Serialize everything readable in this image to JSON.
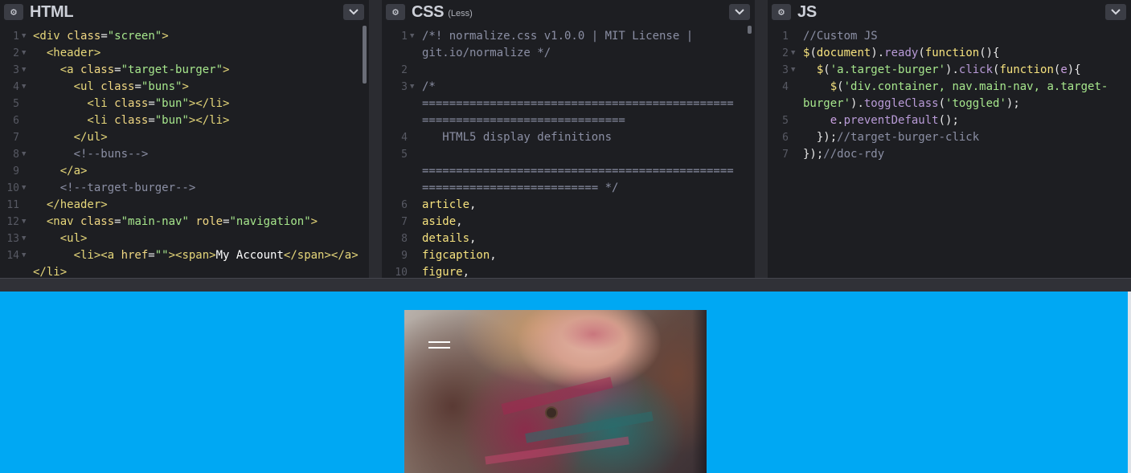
{
  "editors": {
    "html": {
      "title": "HTML",
      "lines": [
        {
          "n": "1",
          "fold": true,
          "segs": [
            [
              "c-tag",
              "<div "
            ],
            [
              "c-attr",
              "class"
            ],
            [
              "c-punc",
              "="
            ],
            [
              "c-str",
              "\"screen\""
            ],
            [
              "c-tag",
              ">"
            ]
          ]
        },
        {
          "n": "2",
          "fold": true,
          "segs": [
            [
              "c-tag",
              "  <header>"
            ]
          ]
        },
        {
          "n": "3",
          "fold": true,
          "segs": [
            [
              "c-tag",
              "    <a "
            ],
            [
              "c-attr",
              "class"
            ],
            [
              "c-punc",
              "="
            ],
            [
              "c-str",
              "\"target-burger\""
            ],
            [
              "c-tag",
              ">"
            ]
          ]
        },
        {
          "n": "4",
          "fold": true,
          "segs": [
            [
              "c-tag",
              "      <ul "
            ],
            [
              "c-attr",
              "class"
            ],
            [
              "c-punc",
              "="
            ],
            [
              "c-str",
              "\"buns\""
            ],
            [
              "c-tag",
              ">"
            ]
          ]
        },
        {
          "n": "5",
          "fold": false,
          "segs": [
            [
              "c-tag",
              "        <li "
            ],
            [
              "c-attr",
              "class"
            ],
            [
              "c-punc",
              "="
            ],
            [
              "c-str",
              "\"bun\""
            ],
            [
              "c-tag",
              "></li>"
            ]
          ]
        },
        {
          "n": "6",
          "fold": false,
          "segs": [
            [
              "c-tag",
              "        <li "
            ],
            [
              "c-attr",
              "class"
            ],
            [
              "c-punc",
              "="
            ],
            [
              "c-str",
              "\"bun\""
            ],
            [
              "c-tag",
              "></li>"
            ]
          ]
        },
        {
          "n": "7",
          "fold": false,
          "segs": [
            [
              "c-tag",
              "      </ul>"
            ]
          ]
        },
        {
          "n": "8",
          "fold": true,
          "segs": [
            [
              "c-comment",
              "      <!--buns-->"
            ]
          ]
        },
        {
          "n": "9",
          "fold": false,
          "segs": [
            [
              "c-tag",
              "    </a>"
            ]
          ]
        },
        {
          "n": "10",
          "fold": true,
          "segs": [
            [
              "c-comment",
              "    <!--target-burger-->"
            ]
          ]
        },
        {
          "n": "11",
          "fold": false,
          "segs": [
            [
              "c-tag",
              "  </header>"
            ]
          ]
        },
        {
          "n": "12",
          "fold": true,
          "segs": [
            [
              "c-tag",
              "  <nav "
            ],
            [
              "c-attr",
              "class"
            ],
            [
              "c-punc",
              "="
            ],
            [
              "c-str",
              "\"main-nav\""
            ],
            [
              "c-attr",
              " role"
            ],
            [
              "c-punc",
              "="
            ],
            [
              "c-str",
              "\"navigation\""
            ],
            [
              "c-tag",
              ">"
            ]
          ]
        },
        {
          "n": "13",
          "fold": true,
          "segs": [
            [
              "c-tag",
              "    <ul>"
            ]
          ]
        },
        {
          "n": "14",
          "fold": true,
          "segs": [
            [
              "c-tag",
              "      <li><a "
            ],
            [
              "c-attr",
              "href"
            ],
            [
              "c-punc",
              "="
            ],
            [
              "c-str",
              "\"\""
            ],
            [
              "c-tag",
              "><span>"
            ],
            [
              "c-text",
              "My Account"
            ],
            [
              "c-tag",
              "</span></a>"
            ]
          ]
        },
        {
          "n": "",
          "fold": false,
          "segs": [
            [
              "c-tag",
              "</li>"
            ]
          ]
        }
      ]
    },
    "css": {
      "title": "CSS",
      "subtitle": "(Less)",
      "lines": [
        {
          "n": "1",
          "fold": true,
          "segs": [
            [
              "c-comment",
              "/*! normalize.css v1.0.0 | MIT License |"
            ]
          ]
        },
        {
          "n": "",
          "fold": false,
          "segs": [
            [
              "c-comment",
              "git.io/normalize */"
            ]
          ]
        },
        {
          "n": "2",
          "fold": false,
          "segs": [
            [
              "c-comment",
              ""
            ]
          ]
        },
        {
          "n": "3",
          "fold": true,
          "segs": [
            [
              "c-comment",
              "/*"
            ]
          ]
        },
        {
          "n": "",
          "fold": false,
          "segs": [
            [
              "c-comment",
              "=============================================="
            ]
          ]
        },
        {
          "n": "",
          "fold": false,
          "segs": [
            [
              "c-comment",
              "=============================="
            ]
          ]
        },
        {
          "n": "4",
          "fold": false,
          "segs": [
            [
              "c-comment",
              "   HTML5 display definitions"
            ]
          ]
        },
        {
          "n": "5",
          "fold": false,
          "segs": [
            [
              "c-comment",
              ""
            ]
          ]
        },
        {
          "n": "",
          "fold": false,
          "segs": [
            [
              "c-comment",
              "=============================================="
            ]
          ]
        },
        {
          "n": "",
          "fold": false,
          "segs": [
            [
              "c-comment",
              "========================== */"
            ]
          ]
        },
        {
          "n": "6",
          "fold": false,
          "segs": [
            [
              "c-sel",
              "article"
            ],
            [
              "c-punc",
              ","
            ]
          ]
        },
        {
          "n": "7",
          "fold": false,
          "segs": [
            [
              "c-sel",
              "aside"
            ],
            [
              "c-punc",
              ","
            ]
          ]
        },
        {
          "n": "8",
          "fold": false,
          "segs": [
            [
              "c-sel",
              "details"
            ],
            [
              "c-punc",
              ","
            ]
          ]
        },
        {
          "n": "9",
          "fold": false,
          "segs": [
            [
              "c-sel",
              "figcaption"
            ],
            [
              "c-punc",
              ","
            ]
          ]
        },
        {
          "n": "10",
          "fold": false,
          "segs": [
            [
              "c-sel",
              "figure"
            ],
            [
              "c-punc",
              ","
            ]
          ]
        }
      ]
    },
    "js": {
      "title": "JS",
      "lines": [
        {
          "n": "1",
          "fold": false,
          "segs": [
            [
              "c-comment",
              "//Custom JS"
            ]
          ]
        },
        {
          "n": "2",
          "fold": true,
          "segs": [
            [
              "c-kw",
              "$"
            ],
            [
              "c-punc",
              "("
            ],
            [
              "c-kw",
              "document"
            ],
            [
              "c-punc",
              ")."
            ],
            [
              "c-fn",
              "ready"
            ],
            [
              "c-punc",
              "("
            ],
            [
              "c-kw",
              "function"
            ],
            [
              "c-punc",
              "(){"
            ]
          ]
        },
        {
          "n": "3",
          "fold": true,
          "segs": [
            [
              "c-kw",
              "  $"
            ],
            [
              "c-punc",
              "("
            ],
            [
              "c-str",
              "'a.target-burger'"
            ],
            [
              "c-punc",
              ")."
            ],
            [
              "c-fn",
              "click"
            ],
            [
              "c-punc",
              "("
            ],
            [
              "c-kw",
              "function"
            ],
            [
              "c-punc",
              "("
            ],
            [
              "c-var",
              "e"
            ],
            [
              "c-punc",
              "){"
            ]
          ]
        },
        {
          "n": "4",
          "fold": false,
          "segs": [
            [
              "c-kw",
              "    $"
            ],
            [
              "c-punc",
              "("
            ],
            [
              "c-str",
              "'div.container, nav.main-nav, a.target-"
            ]
          ]
        },
        {
          "n": "",
          "fold": false,
          "segs": [
            [
              "c-str",
              "burger'"
            ],
            [
              "c-punc",
              ")."
            ],
            [
              "c-fn",
              "toggleClass"
            ],
            [
              "c-punc",
              "("
            ],
            [
              "c-str",
              "'toggled'"
            ],
            [
              "c-punc",
              ");"
            ]
          ]
        },
        {
          "n": "5",
          "fold": false,
          "segs": [
            [
              "c-var",
              "    e"
            ],
            [
              "c-punc",
              "."
            ],
            [
              "c-fn",
              "preventDefault"
            ],
            [
              "c-punc",
              "();"
            ]
          ]
        },
        {
          "n": "6",
          "fold": false,
          "segs": [
            [
              "c-punc",
              "  });"
            ],
            [
              "c-comment",
              "//target-burger-click"
            ]
          ]
        },
        {
          "n": "7",
          "fold": false,
          "segs": [
            [
              "c-punc",
              "});"
            ],
            [
              "c-comment",
              "//doc-rdy"
            ]
          ]
        }
      ]
    }
  },
  "icons": {
    "settings": "gear-icon",
    "collapse": "chevron-down-icon",
    "menu": "hamburger-icon"
  },
  "colors": {
    "editor_bg": "#1d1e22",
    "preview_bg": "#00a8f3"
  }
}
